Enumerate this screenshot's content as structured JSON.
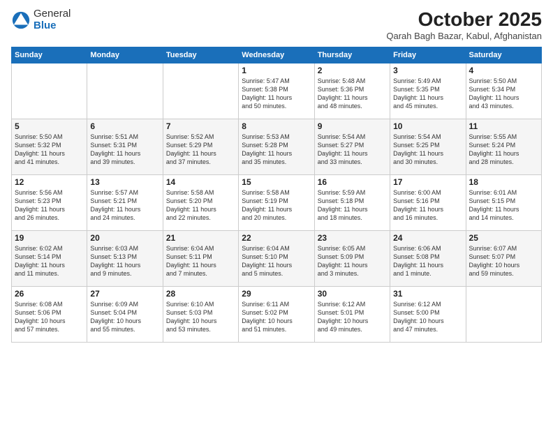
{
  "logo": {
    "general": "General",
    "blue": "Blue"
  },
  "title": "October 2025",
  "location": "Qarah Bagh Bazar, Kabul, Afghanistan",
  "days_of_week": [
    "Sunday",
    "Monday",
    "Tuesday",
    "Wednesday",
    "Thursday",
    "Friday",
    "Saturday"
  ],
  "weeks": [
    [
      {
        "day": "",
        "content": ""
      },
      {
        "day": "",
        "content": ""
      },
      {
        "day": "",
        "content": ""
      },
      {
        "day": "1",
        "content": "Sunrise: 5:47 AM\nSunset: 5:38 PM\nDaylight: 11 hours\nand 50 minutes."
      },
      {
        "day": "2",
        "content": "Sunrise: 5:48 AM\nSunset: 5:36 PM\nDaylight: 11 hours\nand 48 minutes."
      },
      {
        "day": "3",
        "content": "Sunrise: 5:49 AM\nSunset: 5:35 PM\nDaylight: 11 hours\nand 45 minutes."
      },
      {
        "day": "4",
        "content": "Sunrise: 5:50 AM\nSunset: 5:34 PM\nDaylight: 11 hours\nand 43 minutes."
      }
    ],
    [
      {
        "day": "5",
        "content": "Sunrise: 5:50 AM\nSunset: 5:32 PM\nDaylight: 11 hours\nand 41 minutes."
      },
      {
        "day": "6",
        "content": "Sunrise: 5:51 AM\nSunset: 5:31 PM\nDaylight: 11 hours\nand 39 minutes."
      },
      {
        "day": "7",
        "content": "Sunrise: 5:52 AM\nSunset: 5:29 PM\nDaylight: 11 hours\nand 37 minutes."
      },
      {
        "day": "8",
        "content": "Sunrise: 5:53 AM\nSunset: 5:28 PM\nDaylight: 11 hours\nand 35 minutes."
      },
      {
        "day": "9",
        "content": "Sunrise: 5:54 AM\nSunset: 5:27 PM\nDaylight: 11 hours\nand 33 minutes."
      },
      {
        "day": "10",
        "content": "Sunrise: 5:54 AM\nSunset: 5:25 PM\nDaylight: 11 hours\nand 30 minutes."
      },
      {
        "day": "11",
        "content": "Sunrise: 5:55 AM\nSunset: 5:24 PM\nDaylight: 11 hours\nand 28 minutes."
      }
    ],
    [
      {
        "day": "12",
        "content": "Sunrise: 5:56 AM\nSunset: 5:23 PM\nDaylight: 11 hours\nand 26 minutes."
      },
      {
        "day": "13",
        "content": "Sunrise: 5:57 AM\nSunset: 5:21 PM\nDaylight: 11 hours\nand 24 minutes."
      },
      {
        "day": "14",
        "content": "Sunrise: 5:58 AM\nSunset: 5:20 PM\nDaylight: 11 hours\nand 22 minutes."
      },
      {
        "day": "15",
        "content": "Sunrise: 5:58 AM\nSunset: 5:19 PM\nDaylight: 11 hours\nand 20 minutes."
      },
      {
        "day": "16",
        "content": "Sunrise: 5:59 AM\nSunset: 5:18 PM\nDaylight: 11 hours\nand 18 minutes."
      },
      {
        "day": "17",
        "content": "Sunrise: 6:00 AM\nSunset: 5:16 PM\nDaylight: 11 hours\nand 16 minutes."
      },
      {
        "day": "18",
        "content": "Sunrise: 6:01 AM\nSunset: 5:15 PM\nDaylight: 11 hours\nand 14 minutes."
      }
    ],
    [
      {
        "day": "19",
        "content": "Sunrise: 6:02 AM\nSunset: 5:14 PM\nDaylight: 11 hours\nand 11 minutes."
      },
      {
        "day": "20",
        "content": "Sunrise: 6:03 AM\nSunset: 5:13 PM\nDaylight: 11 hours\nand 9 minutes."
      },
      {
        "day": "21",
        "content": "Sunrise: 6:04 AM\nSunset: 5:11 PM\nDaylight: 11 hours\nand 7 minutes."
      },
      {
        "day": "22",
        "content": "Sunrise: 6:04 AM\nSunset: 5:10 PM\nDaylight: 11 hours\nand 5 minutes."
      },
      {
        "day": "23",
        "content": "Sunrise: 6:05 AM\nSunset: 5:09 PM\nDaylight: 11 hours\nand 3 minutes."
      },
      {
        "day": "24",
        "content": "Sunrise: 6:06 AM\nSunset: 5:08 PM\nDaylight: 11 hours\nand 1 minute."
      },
      {
        "day": "25",
        "content": "Sunrise: 6:07 AM\nSunset: 5:07 PM\nDaylight: 10 hours\nand 59 minutes."
      }
    ],
    [
      {
        "day": "26",
        "content": "Sunrise: 6:08 AM\nSunset: 5:06 PM\nDaylight: 10 hours\nand 57 minutes."
      },
      {
        "day": "27",
        "content": "Sunrise: 6:09 AM\nSunset: 5:04 PM\nDaylight: 10 hours\nand 55 minutes."
      },
      {
        "day": "28",
        "content": "Sunrise: 6:10 AM\nSunset: 5:03 PM\nDaylight: 10 hours\nand 53 minutes."
      },
      {
        "day": "29",
        "content": "Sunrise: 6:11 AM\nSunset: 5:02 PM\nDaylight: 10 hours\nand 51 minutes."
      },
      {
        "day": "30",
        "content": "Sunrise: 6:12 AM\nSunset: 5:01 PM\nDaylight: 10 hours\nand 49 minutes."
      },
      {
        "day": "31",
        "content": "Sunrise: 6:12 AM\nSunset: 5:00 PM\nDaylight: 10 hours\nand 47 minutes."
      },
      {
        "day": "",
        "content": ""
      }
    ]
  ]
}
